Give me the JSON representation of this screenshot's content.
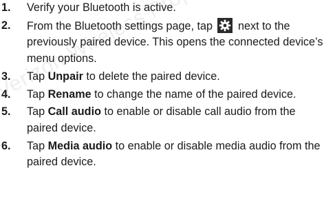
{
  "watermark": "Verizon Wireless Proprietary",
  "steps": [
    {
      "number": "1.",
      "text": "Verify your Bluetooth is active."
    },
    {
      "number": "2.",
      "text_before": "From the Bluetooth settings page, tap",
      "icon": "gear-icon",
      "text_after": "next to the previously paired device. This opens the connected device’s menu options."
    },
    {
      "number": "3.",
      "pre": "Tap",
      "bold": "Unpair",
      "post": "to delete the paired device."
    },
    {
      "number": "4.",
      "pre": "Tap",
      "bold": "Rename",
      "post": "to change the name of the paired device."
    },
    {
      "number": "5.",
      "pre": "Tap",
      "bold": "Call audio",
      "post": "to enable or disable call audio from the paired device."
    },
    {
      "number": "6.",
      "pre": "Tap",
      "bold": "Media audio",
      "post": "to enable or disable media audio from the paired device."
    }
  ],
  "colors": {
    "text": "#1a1a1a",
    "icon_background": "#2b2b2b",
    "icon_foreground": "#ffffff",
    "watermark": "#eeeeee"
  }
}
